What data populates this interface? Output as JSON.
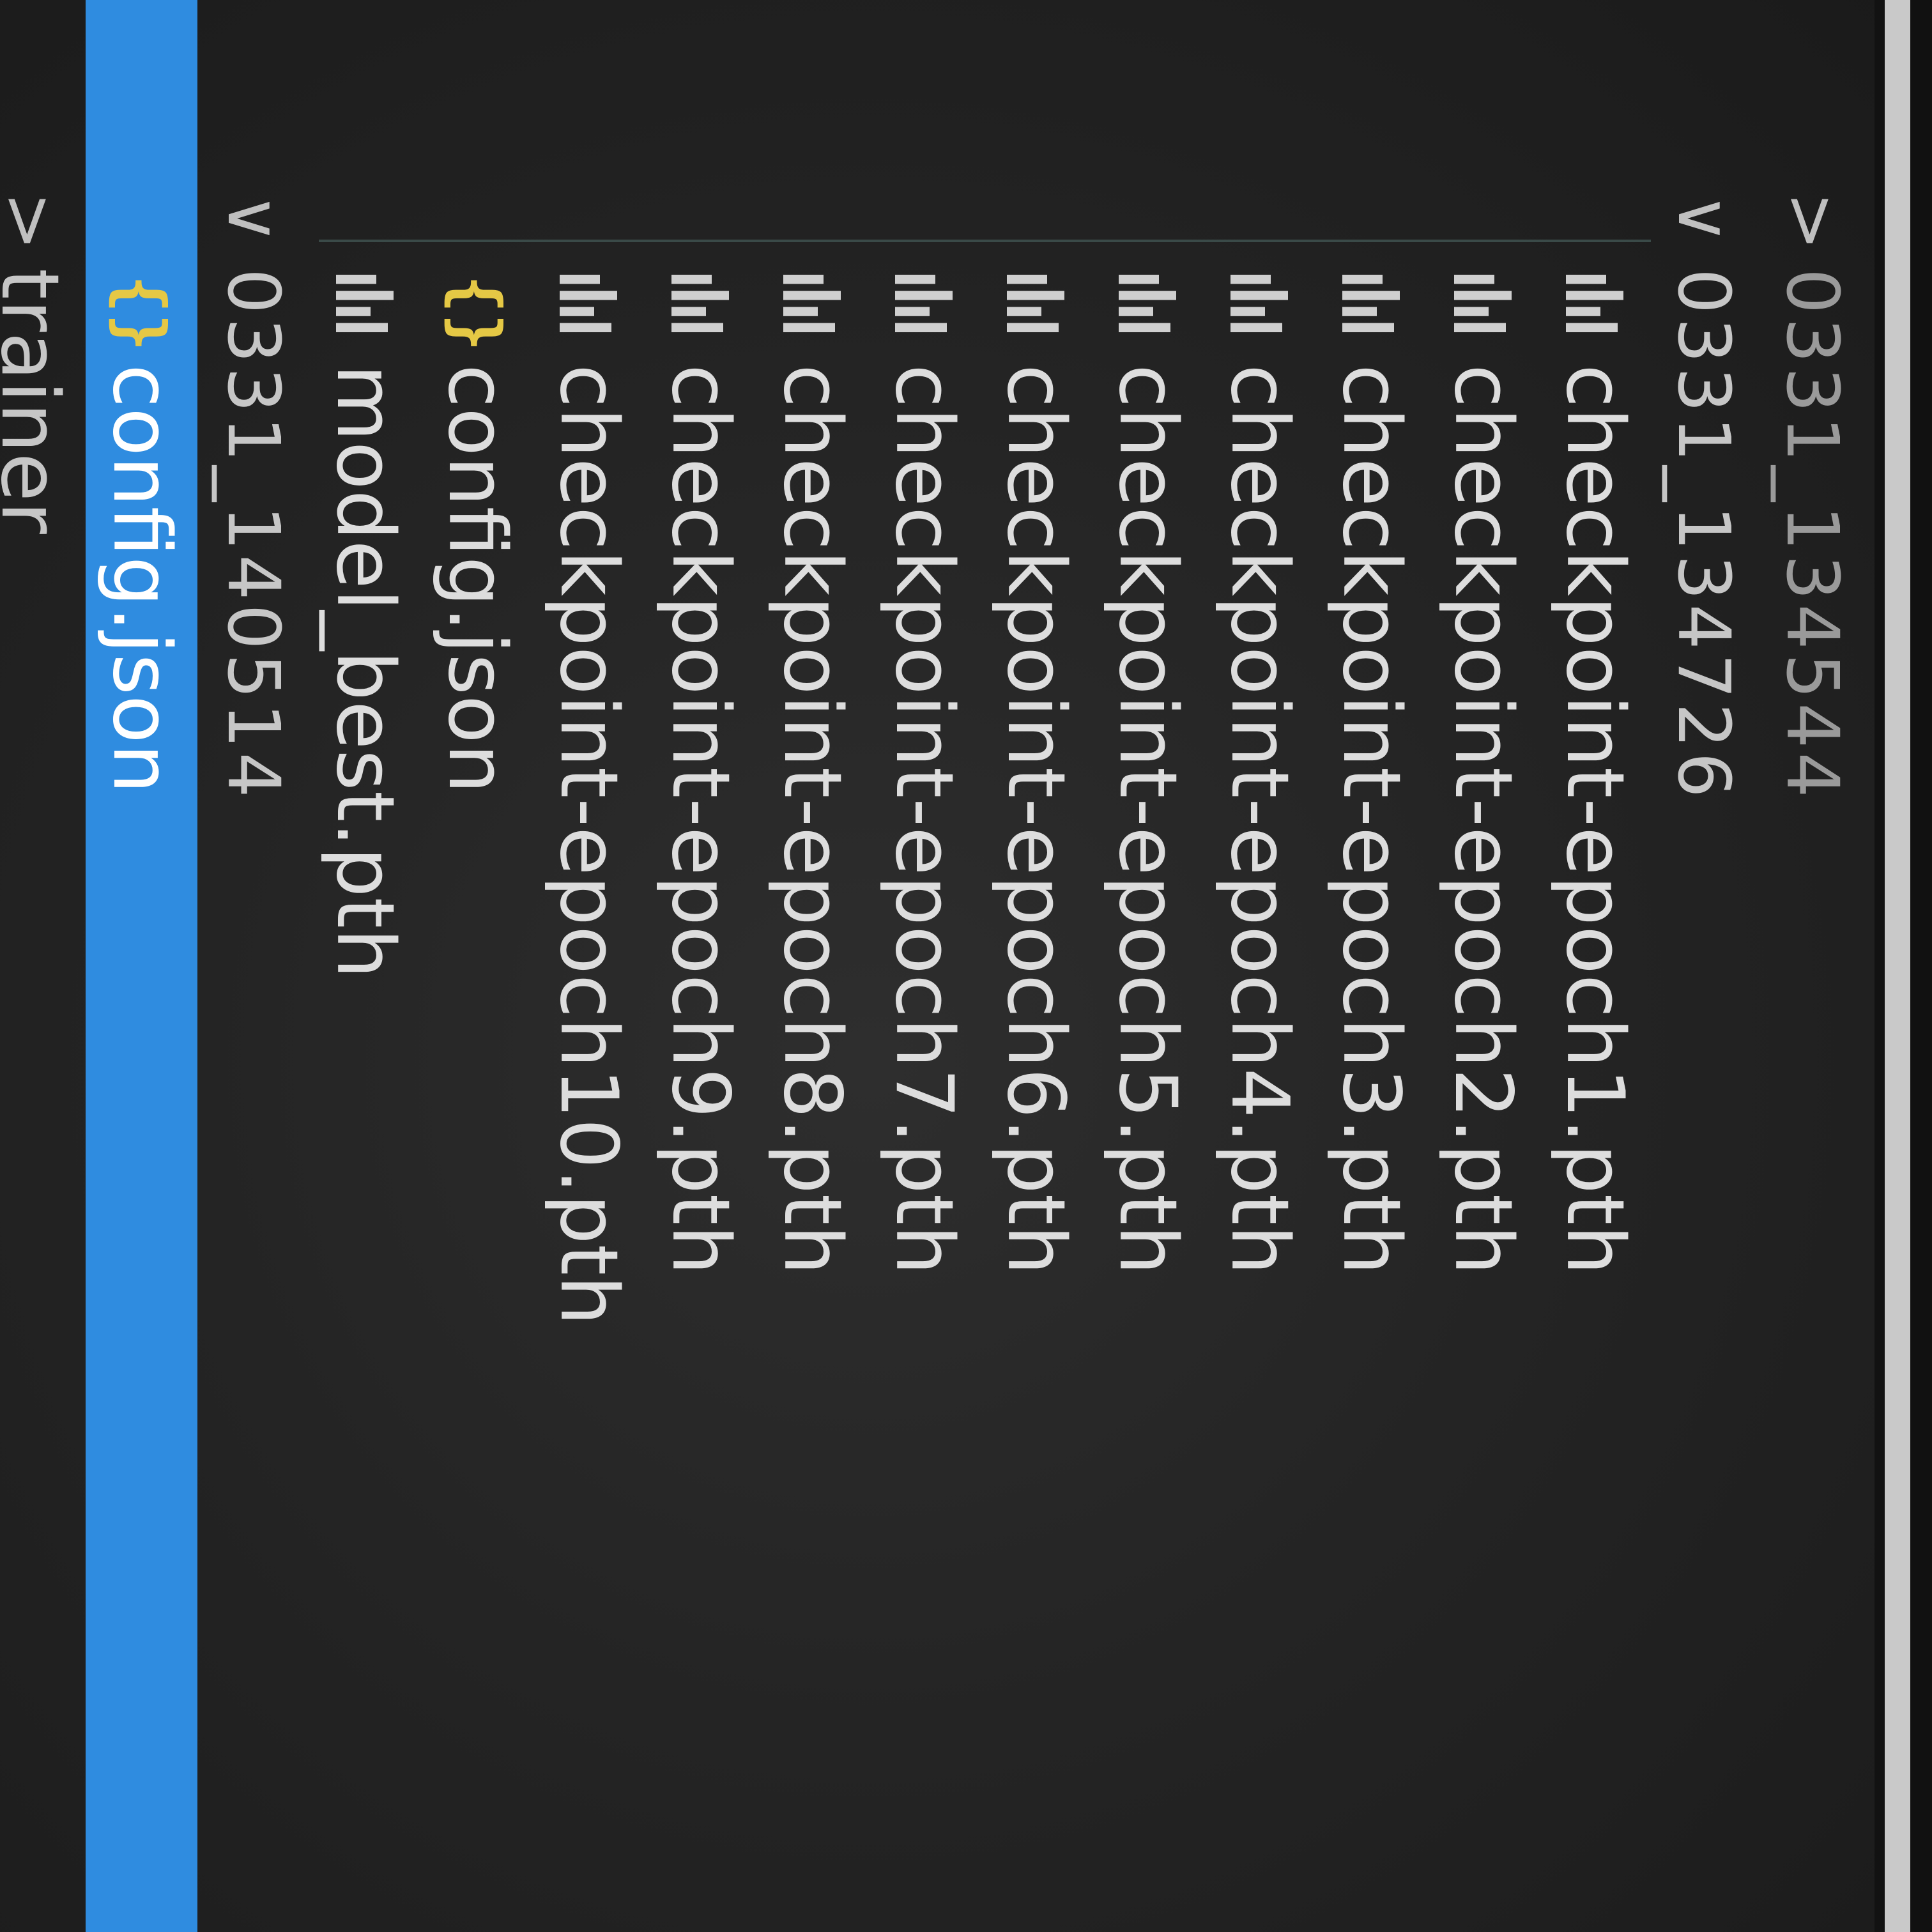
{
  "theme": {
    "background": "#252526",
    "selection": "#2f8ce0",
    "json_icon_color": "#e5c845",
    "text": "#dddddd"
  },
  "explorer": {
    "folders": [
      {
        "name": "0331_134544",
        "expanded": false,
        "chevron": ">"
      },
      {
        "name": "0331_134726",
        "expanded": true,
        "chevron": "∨"
      },
      {
        "name": "0331_140514",
        "expanded": true,
        "chevron": "∨"
      },
      {
        "name": "trainer",
        "expanded": false,
        "chevron": ">"
      }
    ],
    "files_0331_134726": [
      {
        "name": "checkpoint-epoch1.pth",
        "icon": "binary-file-icon"
      },
      {
        "name": "checkpoint-epoch2.pth",
        "icon": "binary-file-icon"
      },
      {
        "name": "checkpoint-epoch3.pth",
        "icon": "binary-file-icon"
      },
      {
        "name": "checkpoint-epoch4.pth",
        "icon": "binary-file-icon"
      },
      {
        "name": "checkpoint-epoch5.pth",
        "icon": "binary-file-icon"
      },
      {
        "name": "checkpoint-epoch6.pth",
        "icon": "binary-file-icon"
      },
      {
        "name": "checkpoint-epoch7.pth",
        "icon": "binary-file-icon"
      },
      {
        "name": "checkpoint-epoch8.pth",
        "icon": "binary-file-icon"
      },
      {
        "name": "checkpoint-epoch9.pth",
        "icon": "binary-file-icon"
      },
      {
        "name": "checkpoint-epoch10.pth",
        "icon": "binary-file-icon"
      },
      {
        "name": "config.json",
        "icon": "json-braces-icon"
      },
      {
        "name": "model_best.pth",
        "icon": "binary-file-icon"
      }
    ],
    "files_0331_140514": [
      {
        "name": "config.json",
        "icon": "json-braces-icon",
        "selected": true
      }
    ],
    "json_icon_glyph": "{}"
  }
}
